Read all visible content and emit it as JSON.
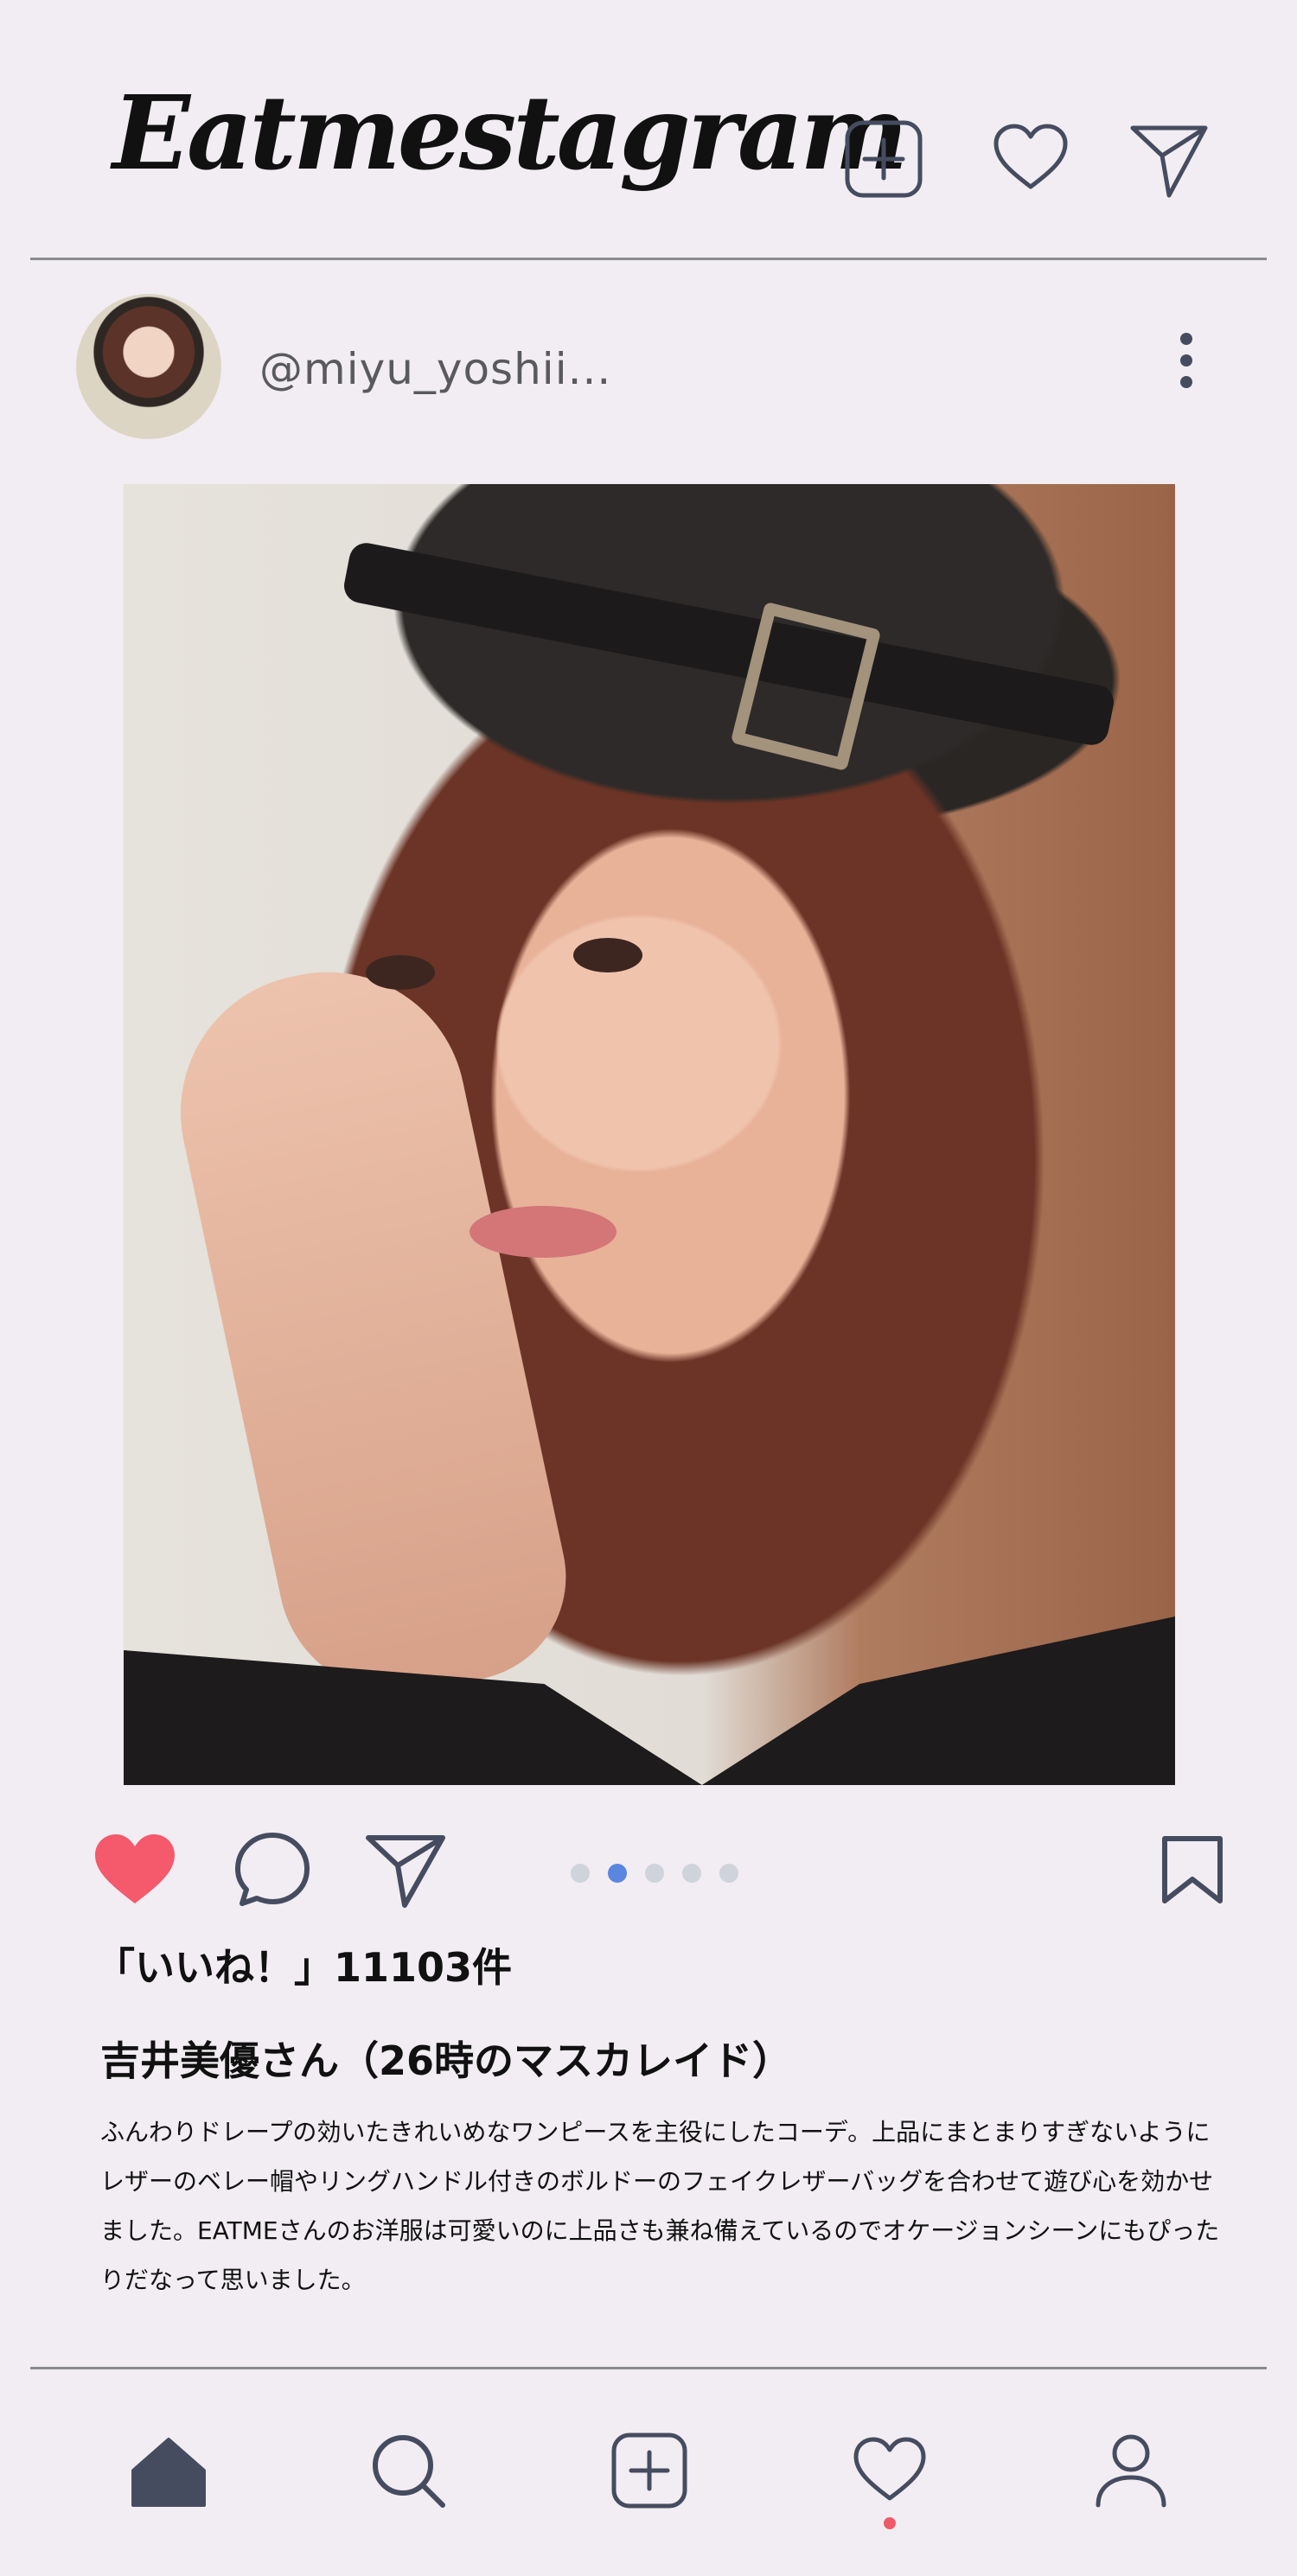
{
  "app": {
    "title": "Eatmestagram"
  },
  "header": {
    "icons": [
      "add-post-icon",
      "heart-icon",
      "send-icon"
    ]
  },
  "post": {
    "username": "@miyu_yoshii...",
    "image_alt": "Portrait of woman wearing a black leather beret",
    "carousel": {
      "total": 5,
      "active": 2
    },
    "likes_text": "「いいね！」11103件",
    "title": "吉井美優さん（26時のマスカレイド）",
    "caption": "ふんわりドレープの効いたきれいめなワンピースを主役にしたコーデ。上品にまとまりすぎないようにレザーのベレー帽やリングハンドル付きのボルドーのフェイクレザーバッグを合わせて遊び心を効かせました。EATMEさんのお洋服は可愛いのに上品さも兼ね備えているのでオケージョンシーンにもぴったりだなって思いました。"
  },
  "colors": {
    "background": "#f1edf2",
    "icon": "#464c60",
    "liked": "#f4596c",
    "carousel_active": "#5b86e0",
    "carousel_inactive": "#cfd3dc",
    "notification_dot": "#ef5a6a"
  },
  "bottom_nav": {
    "items": [
      "home-icon",
      "search-icon",
      "create-icon",
      "activity-icon",
      "profile-icon"
    ],
    "active": "home-icon"
  }
}
